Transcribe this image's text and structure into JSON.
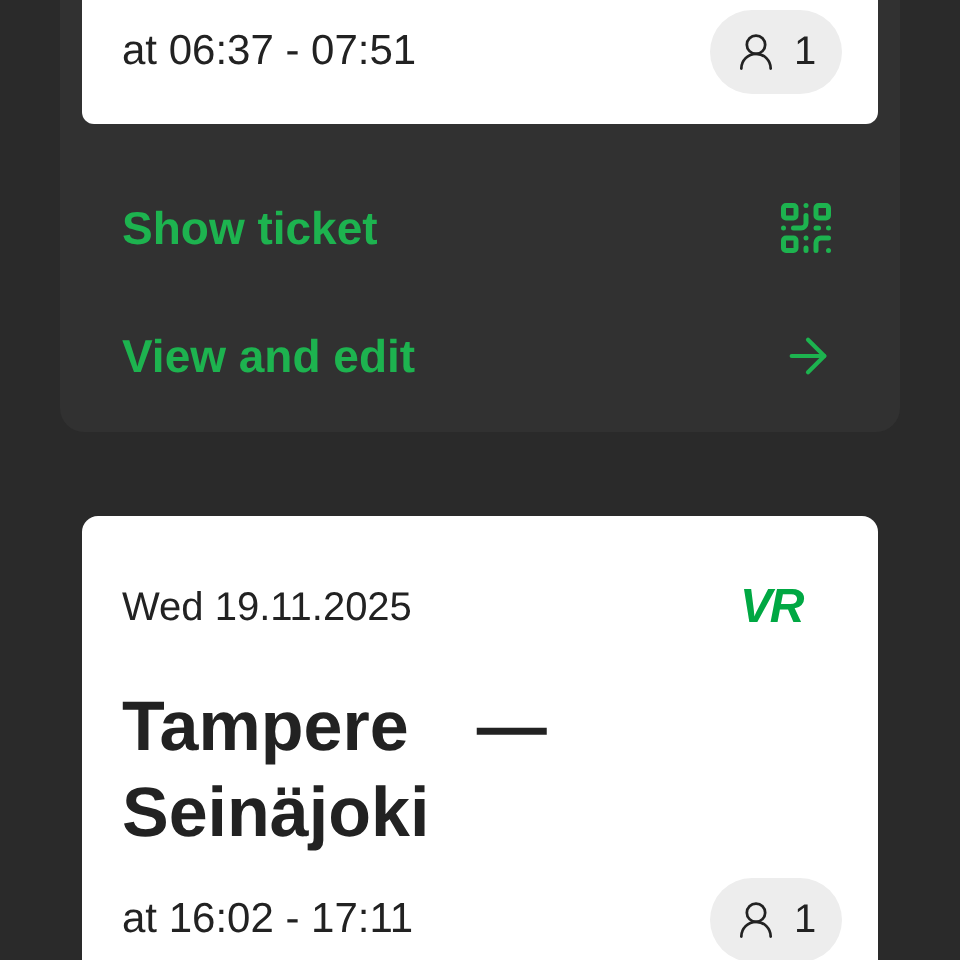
{
  "trips": [
    {
      "time": "at 06:37 - 07:51",
      "passengers": "1",
      "actions": [
        {
          "kind": "qr",
          "label": "Show ticket"
        },
        {
          "kind": "arrow",
          "label": "View and edit"
        }
      ]
    },
    {
      "date": "Wed 19.11.2025",
      "logo": "VR",
      "route": {
        "from": "Tampere",
        "separator": "—",
        "to": "Seinäjoki"
      },
      "time": "at 16:02 - 17:11",
      "passengers": "1"
    }
  ]
}
